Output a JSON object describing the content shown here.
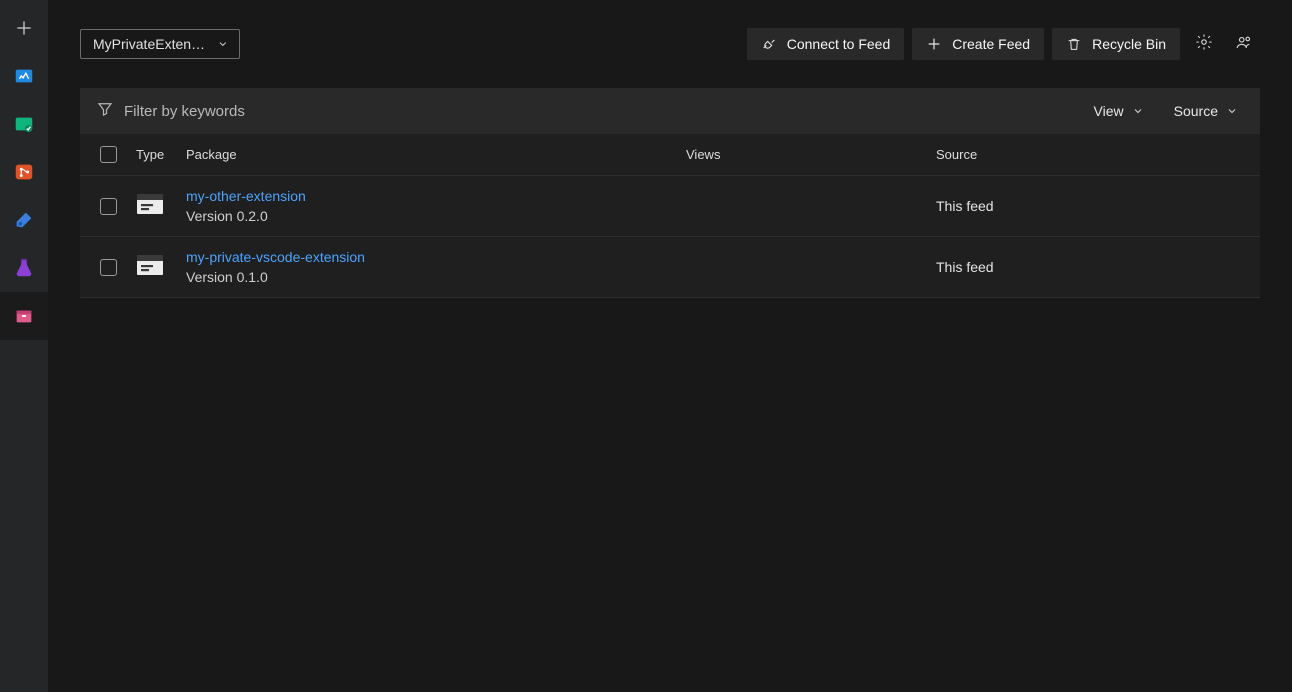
{
  "feed_selector": {
    "selected": "MyPrivateExtensi..."
  },
  "toolbar": {
    "connect": "Connect to Feed",
    "create": "Create Feed",
    "recycle": "Recycle Bin"
  },
  "filter": {
    "placeholder": "Filter by keywords",
    "view_label": "View",
    "source_label": "Source"
  },
  "columns": {
    "type": "Type",
    "package": "Package",
    "views": "Views",
    "source": "Source"
  },
  "packages": [
    {
      "name": "my-other-extension",
      "version": "Version 0.2.0",
      "views": "",
      "source": "This feed"
    },
    {
      "name": "my-private-vscode-extension",
      "version": "Version 0.1.0",
      "views": "",
      "source": "This feed"
    }
  ]
}
